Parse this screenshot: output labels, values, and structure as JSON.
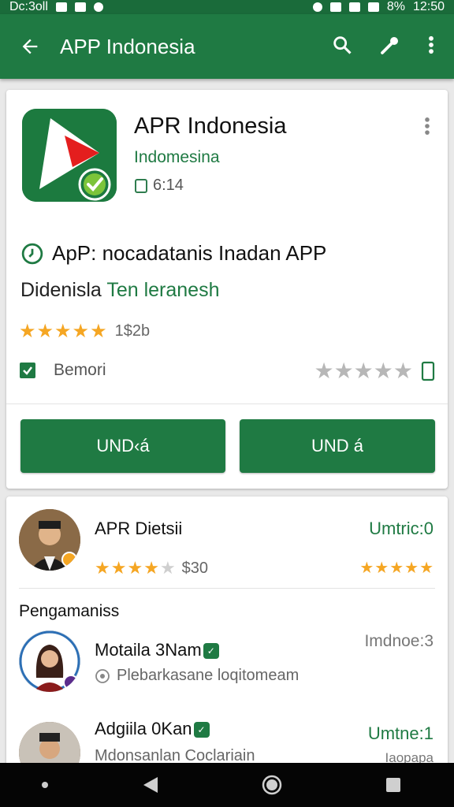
{
  "status_bar": {
    "carrier": "Dc:3oll",
    "battery": "8%",
    "time": "12:50"
  },
  "app_bar": {
    "title": "APP Indonesia"
  },
  "app": {
    "name": "APR Indonesia",
    "developer": "Indomesina",
    "size": "6:14",
    "description_line1": "ApP: nocadatanis Inadan APP",
    "description_line2_plain": "Didenisla ",
    "description_line2_accent": "Ten leranesh",
    "rating_stars": 4.5,
    "rating_count": "1$2b",
    "version_label": "Bemori",
    "user_rating_stars": 0,
    "install_label": "UND‹á",
    "open_label": "UND á"
  },
  "reviews_featured": {
    "name": "APR Dietsii",
    "price": "$30",
    "right_label": "Umtric:0",
    "stars": 4.5,
    "right_stars": 5
  },
  "section_title": "Pengamaniss",
  "reviews": [
    {
      "name": "Motaila 3Nam",
      "subtitle": "Plebarkasane loqitomeam",
      "right_label": "Imdnoe:3"
    },
    {
      "name": "Adgiila 0Kan",
      "subtitle": "Mdonsanlan Coclariain",
      "right_label": "Umtne:1",
      "right_sub": "Iaopapa"
    }
  ],
  "colors": {
    "primary": "#1f7a43",
    "star": "#f5a623"
  }
}
